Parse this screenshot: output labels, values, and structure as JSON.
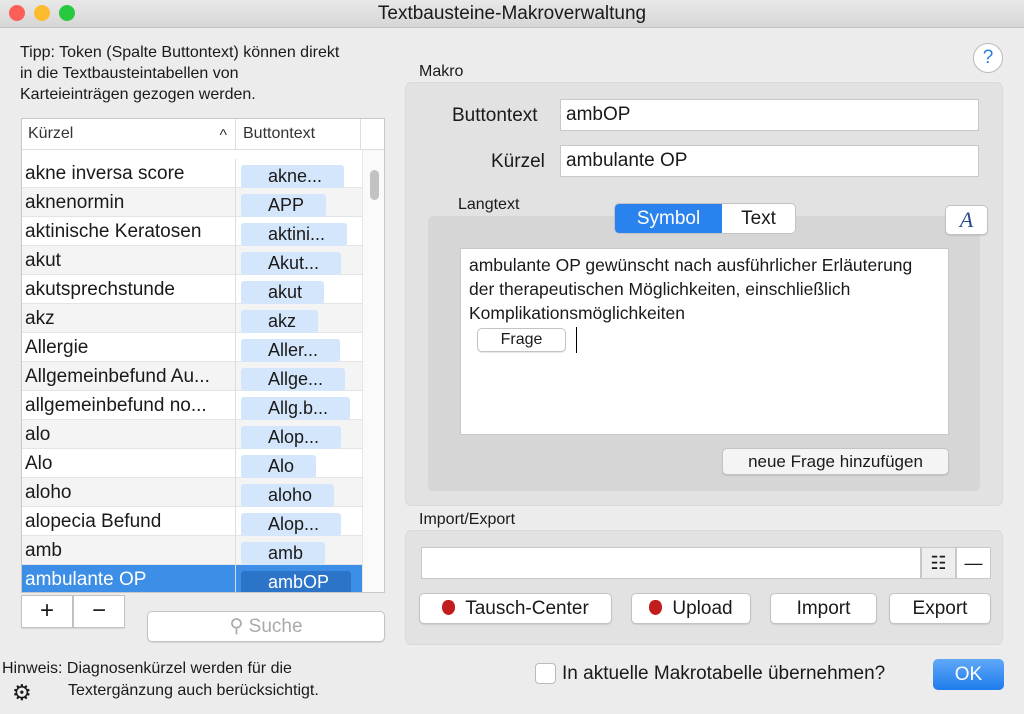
{
  "window": {
    "title": "Textbausteine-Makroverwaltung"
  },
  "tip": "Tipp: Token (Spalte Buttontext) können direkt in die Textbausteintabellen von Karteieinträgen gezogen werden.",
  "help_label": "?",
  "table": {
    "columns": [
      "Kürzel",
      "Buttontext"
    ],
    "sort_indicator": "^",
    "rows": [
      {
        "kuerzel": "akne inversa score",
        "buttontext": "akne..."
      },
      {
        "kuerzel": "aknenormin",
        "buttontext": "APP"
      },
      {
        "kuerzel": "aktinische Keratosen",
        "buttontext": "aktini..."
      },
      {
        "kuerzel": "akut",
        "buttontext": "Akut..."
      },
      {
        "kuerzel": "akutsprechstunde",
        "buttontext": "akut"
      },
      {
        "kuerzel": "akz",
        "buttontext": "akz"
      },
      {
        "kuerzel": "Allergie",
        "buttontext": "Aller..."
      },
      {
        "kuerzel": "Allgemeinbefund Au...",
        "buttontext": "Allge..."
      },
      {
        "kuerzel": "allgemeinbefund no...",
        "buttontext": "Allg.b..."
      },
      {
        "kuerzel": "alo",
        "buttontext": "Alop..."
      },
      {
        "kuerzel": "Alo",
        "buttontext": "Alo"
      },
      {
        "kuerzel": "aloho",
        "buttontext": "aloho"
      },
      {
        "kuerzel": "alopecia Befund",
        "buttontext": "Alop..."
      },
      {
        "kuerzel": "amb",
        "buttontext": "amb"
      },
      {
        "kuerzel": "ambulante OP",
        "buttontext": "ambOP",
        "selected": true
      }
    ]
  },
  "add_label": "+",
  "remove_label": "−",
  "search": {
    "placeholder": "Suche"
  },
  "hint": {
    "line1": "Hinweis: Diagnosenkürzel werden für die",
    "line2": "Textergänzung auch berücksichtigt."
  },
  "makro": {
    "title": "Makro",
    "buttontext_label": "Buttontext",
    "buttontext_value": "ambOP",
    "kuerzel_label": "Kürzel",
    "kuerzel_value": "ambulante OP",
    "langtext_label": "Langtext",
    "segments": [
      "Symbol",
      "Text"
    ],
    "active_segment": "Symbol",
    "font_button": "A",
    "langtext": "ambulante OP gewünscht nach ausführlicher Erläuterung der therapeutischen Möglichkeiten, einschließlich Komplikationsmöglichkeiten",
    "token_label": "Frage",
    "add_question": "neue Frage hinzufügen"
  },
  "import_export": {
    "title": "Import/Export",
    "path_value": "",
    "remove_label": "—",
    "buttons": [
      "Tausch-Center",
      "Upload",
      "Import",
      "Export"
    ]
  },
  "checkbox": {
    "label": "In aktuelle Makrotabelle übernehmen?",
    "checked": false
  },
  "ok_label": "OK",
  "colors": {
    "accent": "#2a82ee",
    "selection": "#3d8ee6",
    "token": "#d4e6fb"
  }
}
